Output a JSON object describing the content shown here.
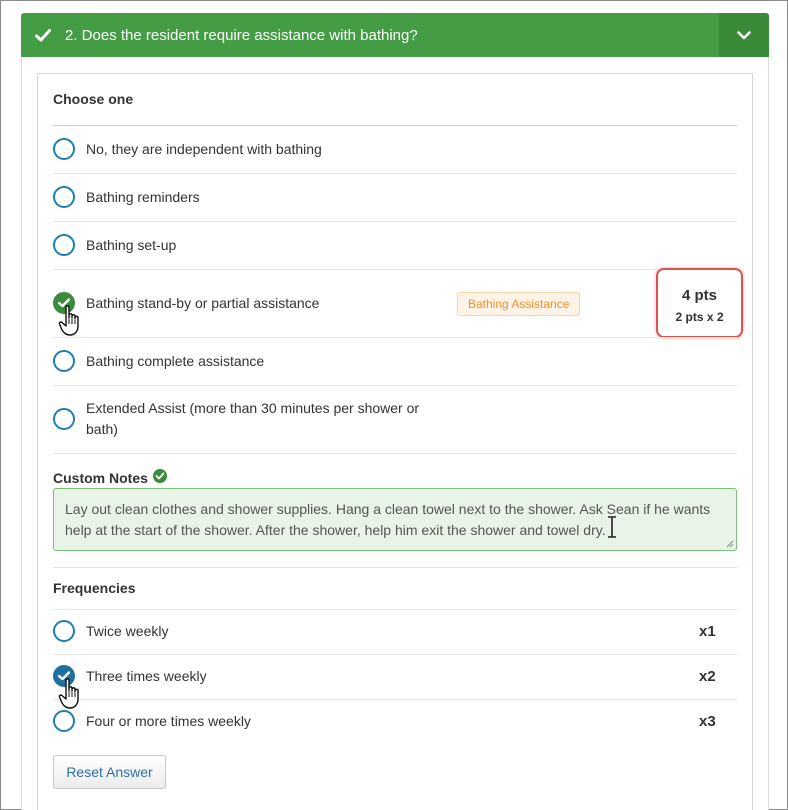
{
  "header": {
    "title": "2. Does the resident require assistance with bathing?"
  },
  "choose": {
    "title": "Choose one",
    "options": [
      {
        "label": "No, they are independent with bathing"
      },
      {
        "label": "Bathing reminders"
      },
      {
        "label": "Bathing set-up"
      },
      {
        "label": "Bathing stand-by or partial assistance",
        "selected": true
      },
      {
        "label": "Bathing complete assistance"
      },
      {
        "label": "Extended Assist (more than 30 minutes per shower or bath)"
      }
    ],
    "tag": "Bathing Assistance",
    "points": "4 pts",
    "points_detail": "2 pts x 2"
  },
  "notes": {
    "label": "Custom Notes",
    "text": "Lay out clean clothes and shower supplies. Hang a clean towel next to the shower. Ask Sean if he wants help at the start of the shower. After the shower, help him exit the shower and towel dry."
  },
  "frequencies": {
    "title": "Frequencies",
    "items": [
      {
        "label": "Twice weekly",
        "multiplier": "x1"
      },
      {
        "label": "Three times weekly",
        "multiplier": "x2",
        "selected": true
      },
      {
        "label": "Four or more times weekly",
        "multiplier": "x3"
      }
    ]
  },
  "reset_label": "Reset Answer",
  "colors": {
    "header_green": "#449d44",
    "selected_green": "#3d8b3d",
    "radio_blue": "#1f7fb5",
    "highlight_red": "#d9534f",
    "tag_orange": "#f0932b"
  }
}
